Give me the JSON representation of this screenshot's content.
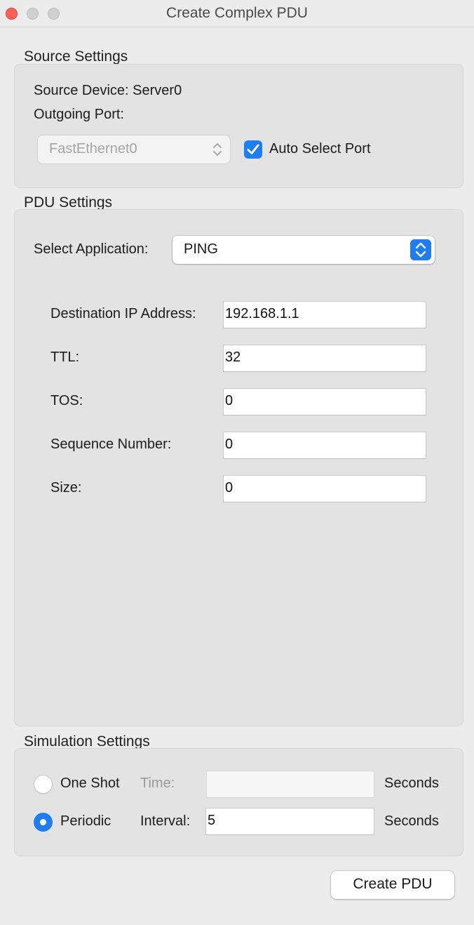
{
  "window": {
    "title": "Create Complex PDU"
  },
  "source_settings": {
    "heading": "Source Settings",
    "source_device_label": "Source Device: Server0",
    "outgoing_port_label": "Outgoing Port:",
    "port_select_value": "FastEthernet0",
    "auto_select_label": "Auto Select Port",
    "auto_select_checked": true
  },
  "pdu_settings": {
    "heading": "PDU Settings",
    "select_application_label": "Select Application:",
    "application_value": "PING",
    "fields": [
      {
        "label": "Destination IP Address:",
        "value": "192.168.1.1"
      },
      {
        "label": "TTL:",
        "value": "32"
      },
      {
        "label": "TOS:",
        "value": "0"
      },
      {
        "label": "Sequence Number:",
        "value": "0"
      },
      {
        "label": "Size:",
        "value": "0"
      }
    ]
  },
  "simulation_settings": {
    "heading": "Simulation Settings",
    "one_shot_label": "One Shot",
    "time_label": "Time:",
    "time_value": "",
    "periodic_label": "Periodic",
    "interval_label": "Interval:",
    "interval_value": "5",
    "seconds_label_1": "Seconds",
    "seconds_label_2": "Seconds",
    "selected_mode": "Periodic"
  },
  "actions": {
    "create_pdu_label": "Create PDU"
  },
  "colors": {
    "accent": "#1e7df0",
    "close_button": "#fe5f57"
  }
}
